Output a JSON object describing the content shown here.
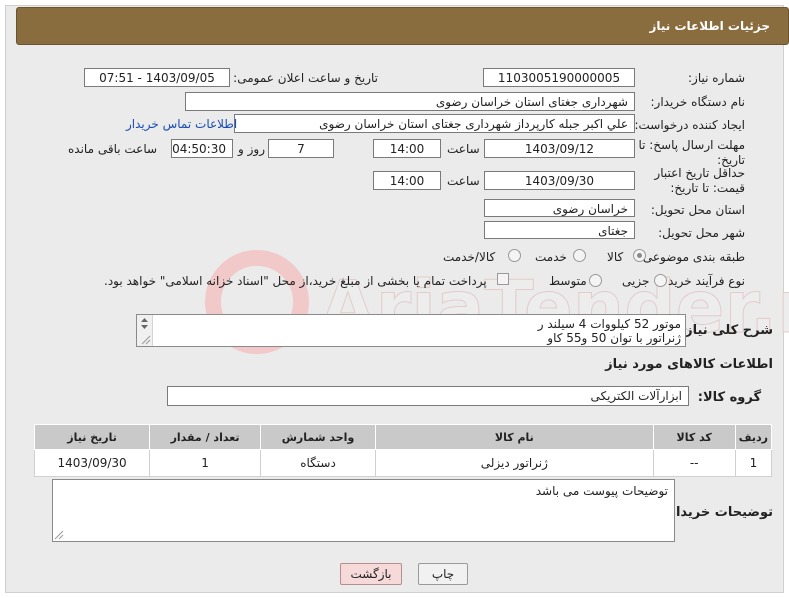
{
  "header": {
    "title": "جزئیات اطلاعات نیاز"
  },
  "form": {
    "need_number_label": "شماره نیاز:",
    "need_number": "1103005190000005",
    "announce_label": "تاریخ و ساعت اعلان عمومی:",
    "announce_value": "1403/09/05 - 07:51",
    "buyer_org_label": "نام دستگاه خریدار:",
    "buyer_org": "شهرداری جغتای استان خراسان رضوی",
    "creator_label": "ایجاد کننده درخواست:",
    "creator": "علي اكبر جبله كارپرداز شهرداری جغتای استان خراسان رضوی",
    "contact_link": "اطلاعات تماس خریدار",
    "deadline_label": "مهلت ارسال پاسخ: تا تاریخ:",
    "deadline_date": "1403/09/12",
    "time_label": "ساعت",
    "deadline_time": "14:00",
    "days_value": "7",
    "days_label": "روز و",
    "remaining_time": "04:50:30",
    "remaining_label": "ساعت باقی مانده",
    "validity_label": "حداقل تاریخ اعتبار قیمت: تا تاریخ:",
    "validity_date": "1403/09/30",
    "validity_time": "14:00",
    "province_label": "استان محل تحویل:",
    "province": "خراسان رضوی",
    "city_label": "شهر محل تحویل:",
    "city": "جغتای",
    "category_label": "طبقه بندی موضوعی:",
    "category_options": [
      "کالا",
      "خدمت",
      "کالا/خدمت"
    ],
    "process_label": "نوع فرآیند خرید :",
    "process_options": [
      "جزیی",
      "متوسط"
    ],
    "payment_text": "پرداخت تمام یا بخشی از مبلغ خرید،از محل \"اسناد خزانه اسلامی\" خواهد بود."
  },
  "description": {
    "label": "شرح کلی نیاز:",
    "line1": "موتور 52 کیلووات 4 سیلند ر",
    "line2": "ژنراتور با توان 50 و55 کاو"
  },
  "goods_info_title": "اطلاعات کالاهای مورد نیاز",
  "goods_group": {
    "label": "گروه کالا:",
    "value": "ابزارآلات الکتریکی"
  },
  "table": {
    "headers": [
      "ردیف",
      "کد کالا",
      "نام کالا",
      "واحد شمارش",
      "تعداد / مقدار",
      "تاریخ نیاز"
    ],
    "rows": [
      {
        "row": "1",
        "code": "--",
        "name": "ژنراتور دیزلی",
        "unit": "دستگاه",
        "qty": "1",
        "date": "1403/09/30"
      }
    ]
  },
  "buyer_notes": {
    "label": "توضیحات خریدار:",
    "value": "توضیحات پیوست می باشد"
  },
  "buttons": {
    "print": "چاپ",
    "back": "بازگشت"
  },
  "watermark": {
    "text": "AriaTender.neT"
  }
}
